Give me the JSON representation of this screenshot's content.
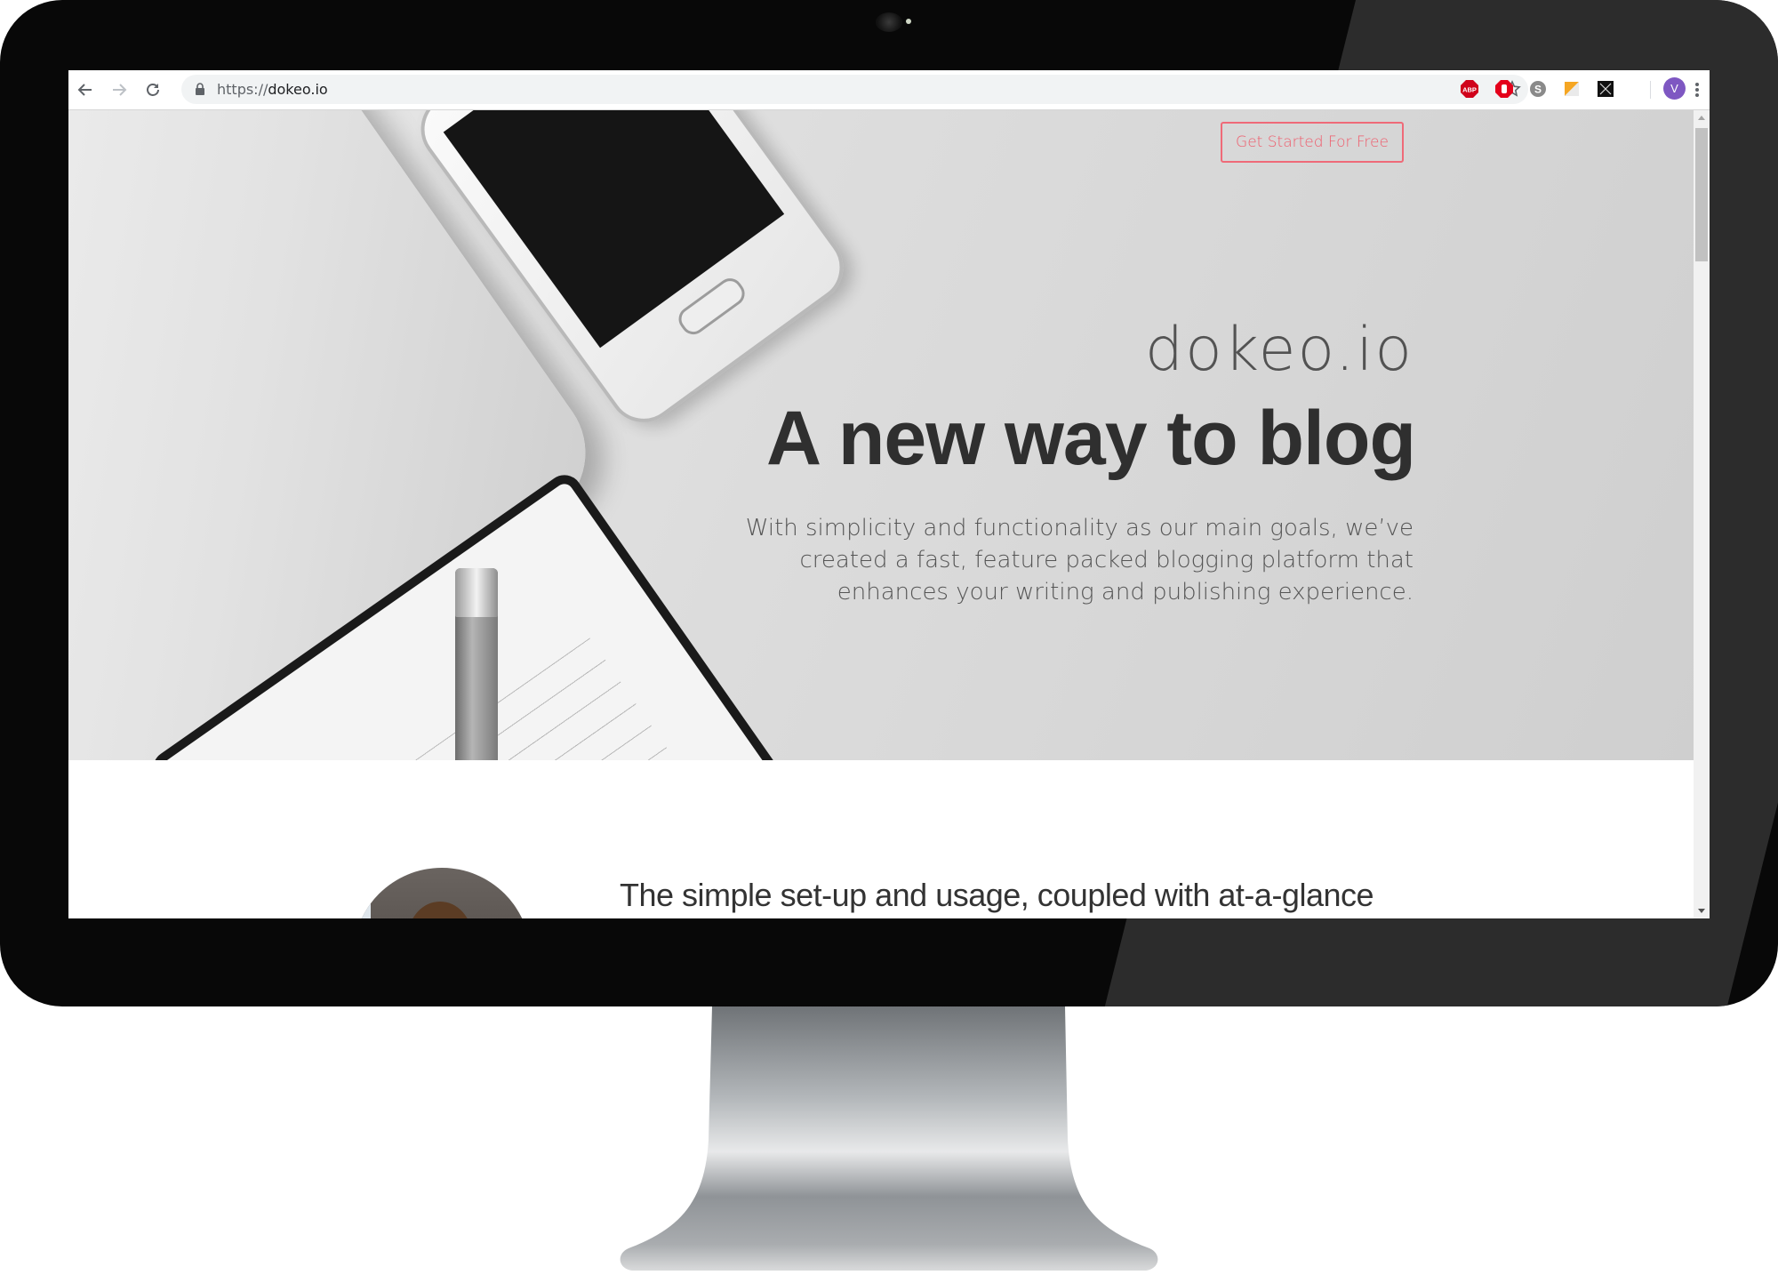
{
  "browser": {
    "url_scheme": "https://",
    "url_host": "dokeo.io",
    "profile_initial": "V",
    "extensions": [
      {
        "name": "adblock-plus-icon",
        "label": "ABP",
        "color": "#d0021b"
      },
      {
        "name": "adblock-hand-icon",
        "label": "",
        "color": "#e4001b"
      },
      {
        "name": "skype-icon",
        "label": "S",
        "color": "#8a8a8a"
      },
      {
        "name": "ruler-extension-icon",
        "label": "",
        "color": "#f5a623"
      },
      {
        "name": "screenshot-extension-icon",
        "label": "",
        "color": "#111111"
      }
    ],
    "profile_color": "#7e57c2"
  },
  "page": {
    "cta_label": "Get Started For Free",
    "brand": "dokeo.io",
    "headline": "A new way to blog",
    "subtitle_lines": [
      "With simplicity and functionality as our main goals, we’ve",
      "created a fast, feature packed blogging platform that",
      "enhances your writing and publishing experience."
    ],
    "testimonial_text": "The simple set-up and usage, coupled with at-a-glance",
    "accent_color": "#ef5b6b"
  }
}
